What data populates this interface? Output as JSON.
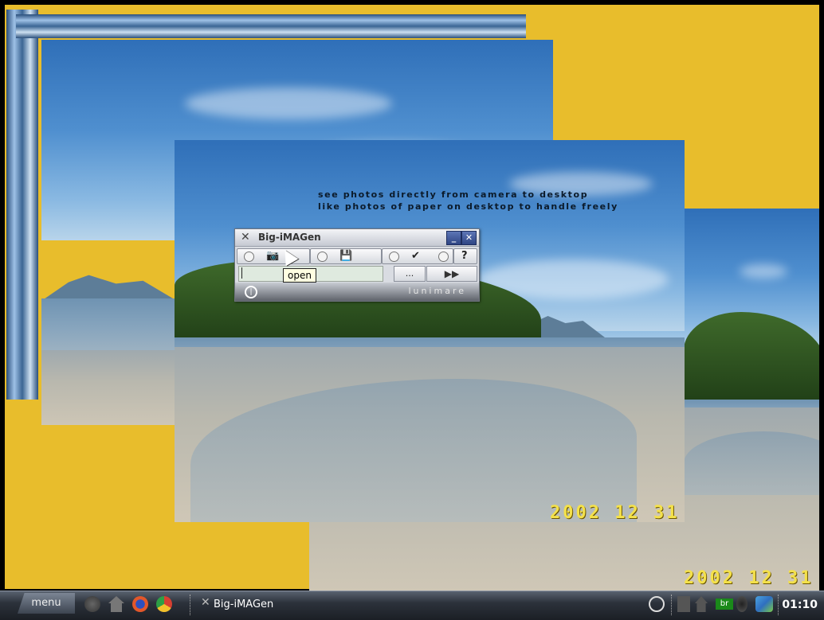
{
  "desktop": {
    "caption_line1": "see photos directly from camera to desktop",
    "caption_line2": "like photos of paper on desktop to handle freely",
    "date_front": "2002 12 31",
    "date_back": "2002 12 31"
  },
  "app": {
    "title": "Big-iMAGen",
    "minimize_glyph": "_",
    "close_glyph": "✕",
    "help_label": "?",
    "browse_label": "...",
    "brand": "lunimare",
    "tooltip": "open",
    "path_value": ""
  },
  "taskbar": {
    "menu_label": "menu",
    "task_label": "Big-iMAGen",
    "keyboard_layout": "br",
    "clock": "01:10"
  },
  "colors": {
    "frame": "#e8bd2c",
    "date_stamp": "#f4e14a",
    "title_button": "#3f57a0"
  }
}
